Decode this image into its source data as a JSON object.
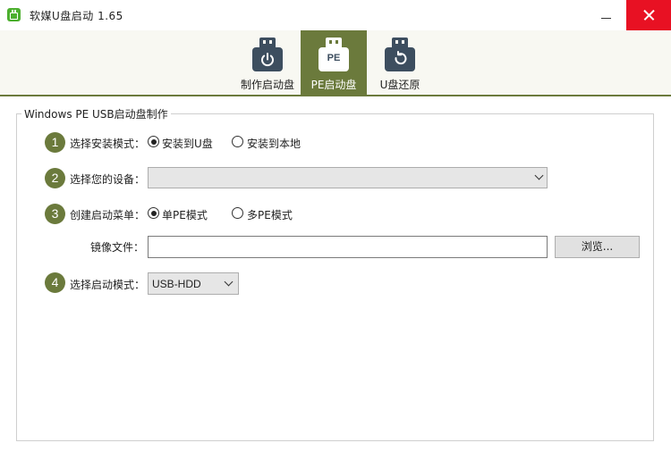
{
  "window": {
    "title": "软媒U盘启动 1.65",
    "accent_color": "#6b7a3c",
    "close_color": "#e81123"
  },
  "tabs": [
    {
      "label": "制作启动盘",
      "icon": "usb-power-icon",
      "selected": false
    },
    {
      "label": "PE启动盘",
      "icon": "usb-pe-icon",
      "icon_text": "PE",
      "selected": true
    },
    {
      "label": "U盘还原",
      "icon": "usb-restore-icon",
      "selected": false
    }
  ],
  "group": {
    "title": "Windows PE USB启动盘制作"
  },
  "steps": {
    "install_mode": {
      "number": "1",
      "label": "选择安装模式：",
      "options": [
        "安装到U盘",
        "安装到本地"
      ],
      "selected": "安装到U盘"
    },
    "device": {
      "number": "2",
      "label": "选择您的设备：",
      "value": ""
    },
    "boot_menu": {
      "number": "3",
      "label": "创建启动菜单：",
      "options": [
        "单PE模式",
        "多PE模式"
      ],
      "selected": "单PE模式"
    },
    "image_file": {
      "label": "镜像文件：",
      "value": "",
      "browse_label": "浏览..."
    },
    "boot_mode": {
      "number": "4",
      "label": "选择启动模式：",
      "value": "USB-HDD"
    }
  }
}
